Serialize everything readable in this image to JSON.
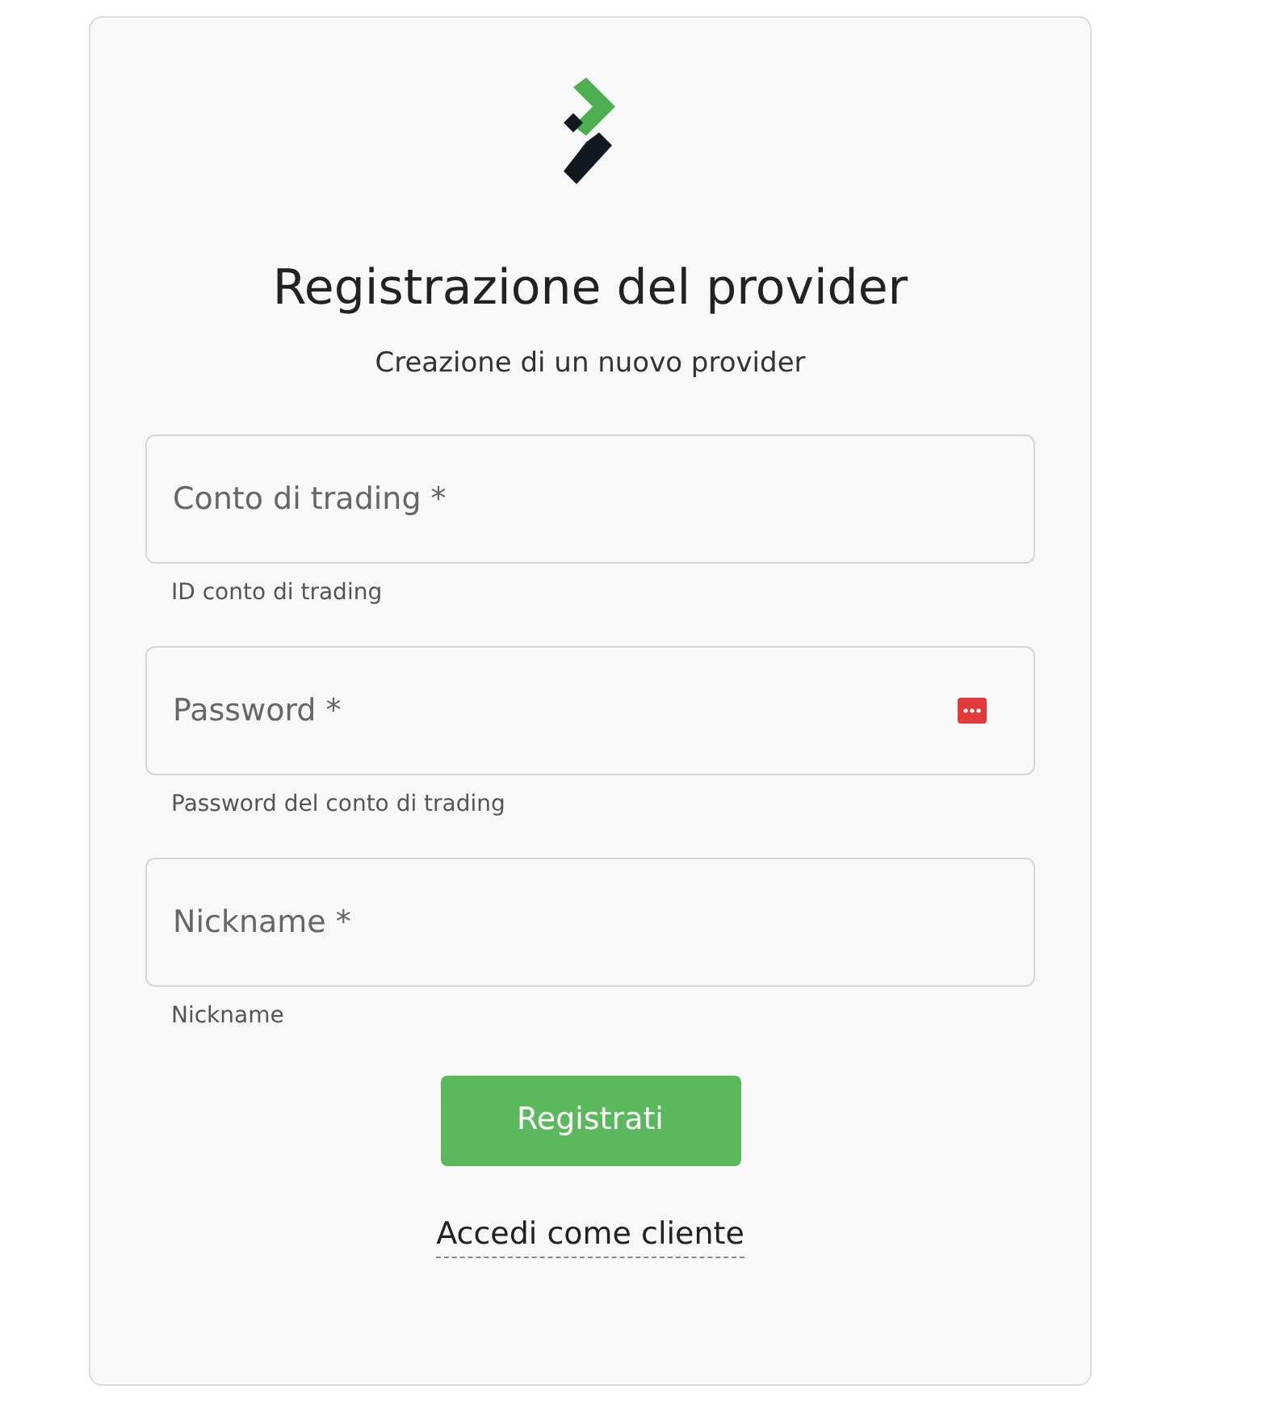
{
  "title": "Registrazione del provider",
  "subtitle": "Creazione di un nuovo provider",
  "fields": [
    {
      "kind": "text",
      "placeholder": "Conto di trading *",
      "hint": "ID conto di trading"
    },
    {
      "kind": "password",
      "placeholder": "Password *",
      "hint": "Password del conto di trading"
    },
    {
      "kind": "text",
      "placeholder": "Nickname *",
      "hint": "Nickname"
    }
  ],
  "submit": "Registrati",
  "link": "Accedi come cliente"
}
